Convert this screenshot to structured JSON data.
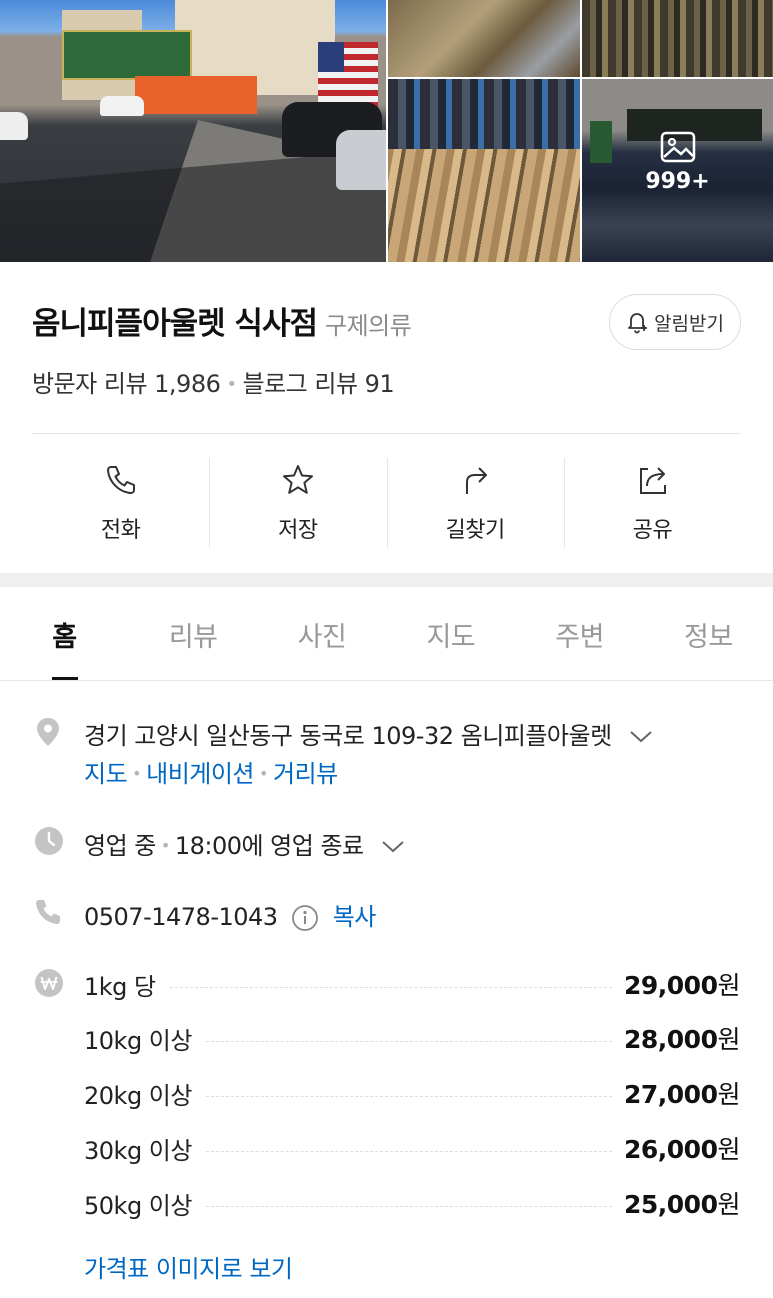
{
  "photos": {
    "more_count": "999+"
  },
  "place": {
    "name": "옴니피플아울렛 식사점",
    "category": "구제의류",
    "alarm_label": "알림받기",
    "visitor_reviews": "방문자 리뷰 1,986",
    "blog_reviews": "블로그 리뷰 91"
  },
  "actions": [
    {
      "label": "전화",
      "icon": "phone-icon"
    },
    {
      "label": "저장",
      "icon": "star-icon"
    },
    {
      "label": "길찾기",
      "icon": "directions-icon"
    },
    {
      "label": "공유",
      "icon": "share-icon"
    }
  ],
  "tabs": [
    {
      "label": "홈",
      "active": true
    },
    {
      "label": "리뷰"
    },
    {
      "label": "사진"
    },
    {
      "label": "지도"
    },
    {
      "label": "주변"
    },
    {
      "label": "정보"
    }
  ],
  "info": {
    "address": "경기 고양시 일산동구 동국로 109-32 옴니피플아울렛",
    "address_links": [
      "지도",
      "내비게이션",
      "거리뷰"
    ],
    "status": "영업 중",
    "hours": "18:00에 영업 종료",
    "phone": "0507-1478-1043",
    "copy_label": "복사"
  },
  "prices": [
    {
      "item": "1kg 당",
      "price": "29,000",
      "unit": "원"
    },
    {
      "item": "10kg 이상",
      "price": "28,000",
      "unit": "원"
    },
    {
      "item": "20kg 이상",
      "price": "27,000",
      "unit": "원"
    },
    {
      "item": "30kg 이상",
      "price": "26,000",
      "unit": "원"
    },
    {
      "item": "50kg 이상",
      "price": "25,000",
      "unit": "원"
    }
  ],
  "price_image_link": "가격표 이미지로 보기",
  "colors": {
    "link": "#0068c3",
    "active_tab": "#111111",
    "inactive_tab": "#999999"
  }
}
